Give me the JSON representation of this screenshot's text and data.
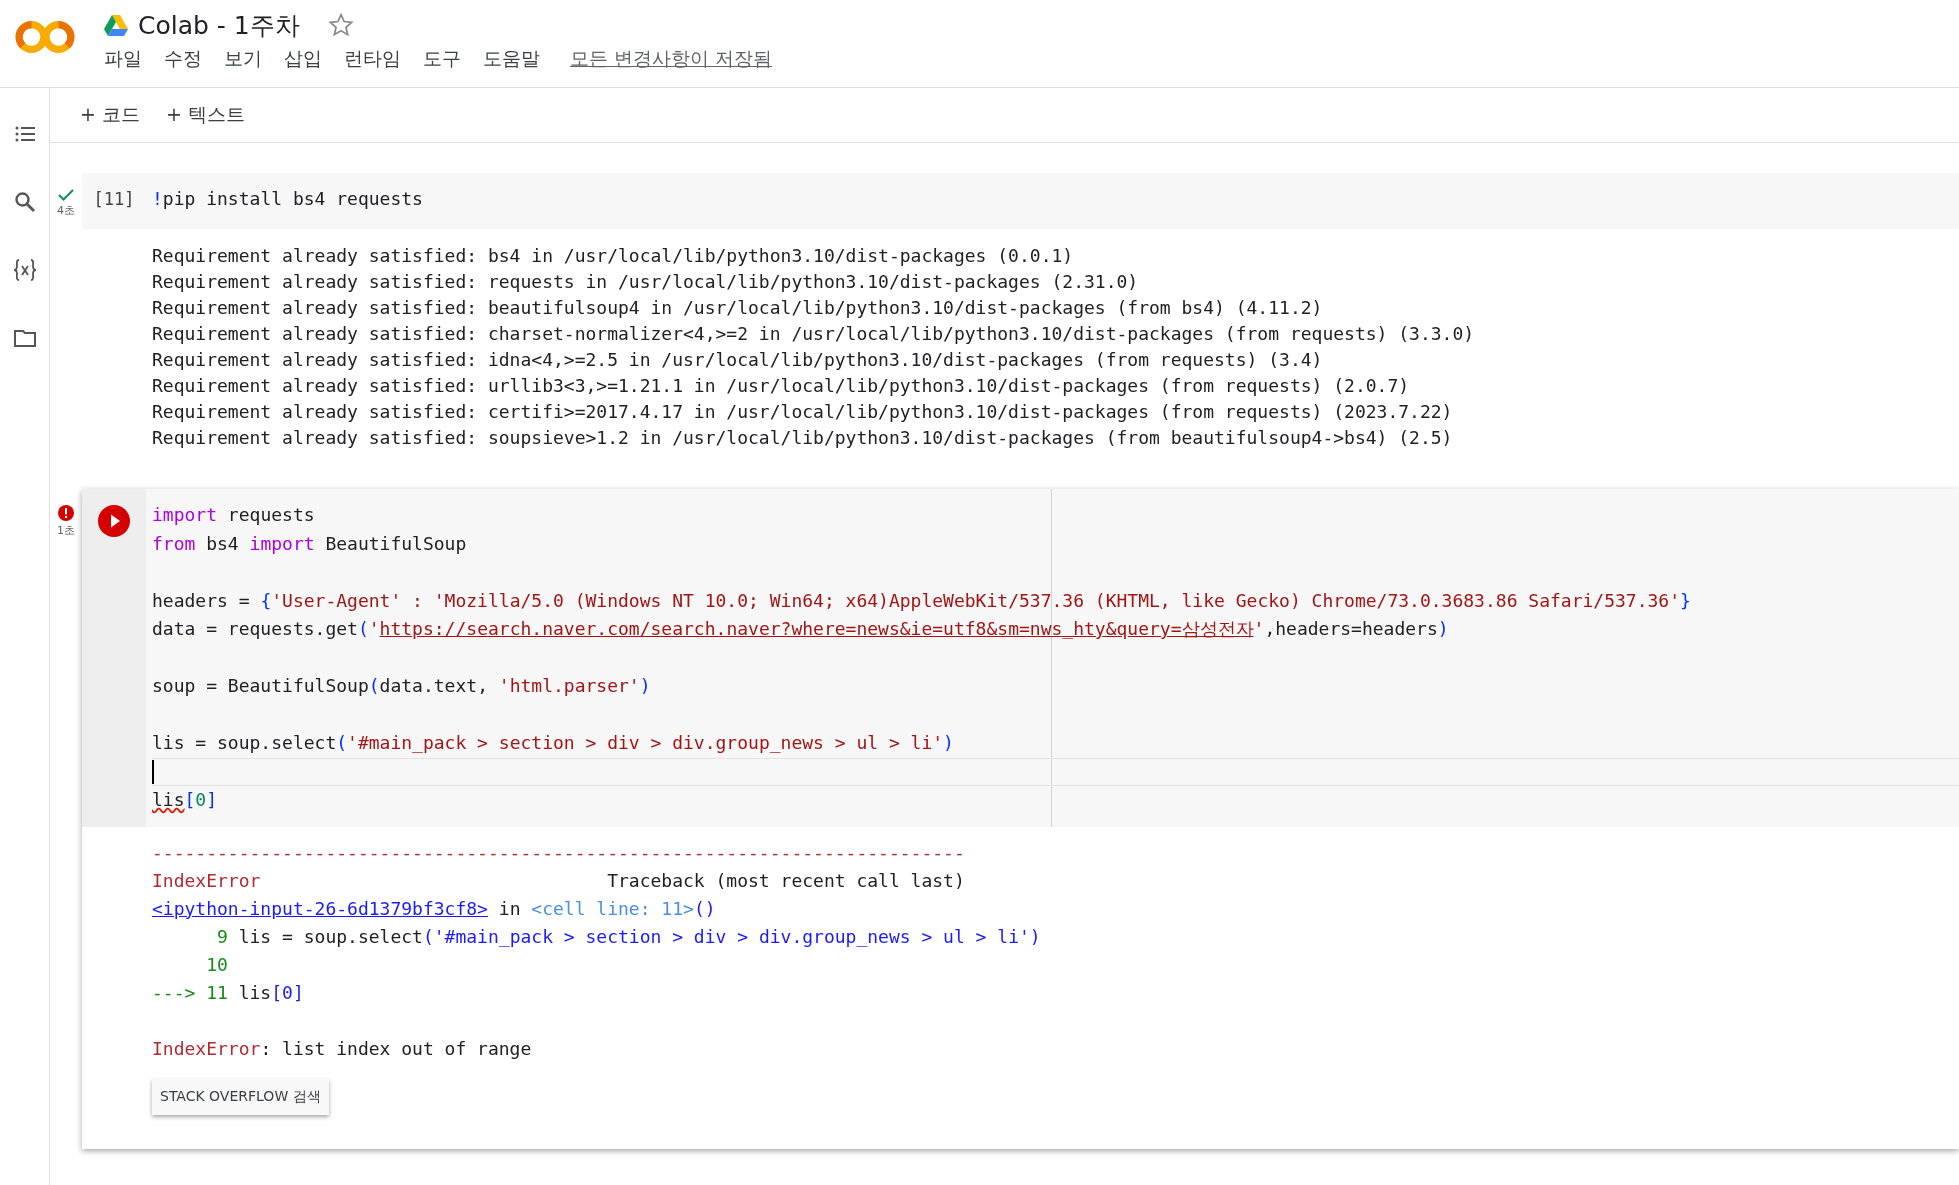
{
  "app": {
    "title": "Colab - 1주차",
    "starred": false,
    "menu": [
      "파일",
      "수정",
      "보기",
      "삽입",
      "런타임",
      "도구",
      "도움말"
    ],
    "save_status": "모든 변경사항이 저장됨"
  },
  "sidebar": [
    {
      "kind": "toc"
    },
    {
      "kind": "search"
    },
    {
      "kind": "variables"
    },
    {
      "kind": "files"
    }
  ],
  "toolbar": [
    "+ 코드",
    "+ 텍스트"
  ],
  "cells": [
    {
      "kind": "success",
      "exec_time": "4초",
      "prompt": "[11]",
      "focused": false,
      "code": [
        {
          "kind": "code",
          "tokens": [
            {
              "text": "!",
              "kind": "bracket"
            },
            {
              "text": "pip install bs4 requests",
              "kind": "plain"
            }
          ]
        }
      ],
      "output": {
        "kind": "stream",
        "lines": [
          {
            "kind": "code",
            "tokens": [
              {
                "text": "Requirement already satisfied: bs4 in /usr/local/lib/python3.10/dist-packages (0.0.1)",
                "kind": "plain"
              }
            ]
          },
          {
            "kind": "code",
            "tokens": [
              {
                "text": "Requirement already satisfied: requests in /usr/local/lib/python3.10/dist-packages (2.31.0)",
                "kind": "plain"
              }
            ]
          },
          {
            "kind": "code",
            "tokens": [
              {
                "text": "Requirement already satisfied: beautifulsoup4 in /usr/local/lib/python3.10/dist-packages (from bs4) (4.11.2)",
                "kind": "plain"
              }
            ]
          },
          {
            "kind": "code",
            "tokens": [
              {
                "text": "Requirement already satisfied: charset-normalizer<4,>=2 in /usr/local/lib/python3.10/dist-packages (from requests) (3.3.0)",
                "kind": "plain"
              }
            ]
          },
          {
            "kind": "code",
            "tokens": [
              {
                "text": "Requirement already satisfied: idna<4,>=2.5 in /usr/local/lib/python3.10/dist-packages (from requests) (3.4)",
                "kind": "plain"
              }
            ]
          },
          {
            "kind": "code",
            "tokens": [
              {
                "text": "Requirement already satisfied: urllib3<3,>=1.21.1 in /usr/local/lib/python3.10/dist-packages (from requests) (2.0.7)",
                "kind": "plain"
              }
            ]
          },
          {
            "kind": "code",
            "tokens": [
              {
                "text": "Requirement already satisfied: certifi>=2017.4.17 in /usr/local/lib/python3.10/dist-packages (from requests) (2023.7.22)",
                "kind": "plain"
              }
            ]
          },
          {
            "kind": "code",
            "tokens": [
              {
                "text": "Requirement already satisfied: soupsieve>1.2 in /usr/local/lib/python3.10/dist-packages (from beautifulsoup4->bs4) (2.5)",
                "kind": "plain"
              }
            ]
          }
        ]
      }
    },
    {
      "kind": "error",
      "exec_time": "1초",
      "focused": true,
      "code": [
        {
          "kind": "code",
          "tokens": [
            {
              "text": "import",
              "kind": "keyword"
            },
            {
              "text": " requests",
              "kind": "plain"
            }
          ]
        },
        {
          "kind": "code",
          "tokens": [
            {
              "text": "from",
              "kind": "keyword"
            },
            {
              "text": " bs4 ",
              "kind": "plain"
            },
            {
              "text": "import",
              "kind": "keyword"
            },
            {
              "text": " BeautifulSoup",
              "kind": "plain"
            }
          ]
        },
        {
          "kind": "blank"
        },
        {
          "kind": "code",
          "tokens": [
            {
              "text": "headers = ",
              "kind": "plain"
            },
            {
              "text": "{",
              "kind": "bracket"
            },
            {
              "text": "'User-Agent' : 'Mozilla/5.0 (Windows NT 10.0; Win64; x64)AppleWebKit/537.36 (KHTML, like Gecko) Chrome/73.0.3683.86 Safari/537.36'",
              "kind": "string"
            },
            {
              "text": "}",
              "kind": "bracket"
            }
          ]
        },
        {
          "kind": "code",
          "tokens": [
            {
              "text": "data = requests.get",
              "kind": "plain"
            },
            {
              "text": "(",
              "kind": "bracket"
            },
            {
              "text": "'",
              "kind": "string"
            },
            {
              "text": "https://search.naver.com/search.naver?where=news&ie=utf8&sm=nws_hty&query=삼성전자",
              "kind": "link"
            },
            {
              "text": "'",
              "kind": "string"
            },
            {
              "text": ",headers=headers",
              "kind": "plain"
            },
            {
              "text": ")",
              "kind": "bracket"
            }
          ]
        },
        {
          "kind": "blank"
        },
        {
          "kind": "code",
          "tokens": [
            {
              "text": "soup = BeautifulSoup",
              "kind": "plain"
            },
            {
              "text": "(",
              "kind": "bracket"
            },
            {
              "text": "data.text, ",
              "kind": "plain"
            },
            {
              "text": "'html.parser'",
              "kind": "string"
            },
            {
              "text": ")",
              "kind": "bracket"
            }
          ]
        },
        {
          "kind": "blank"
        },
        {
          "kind": "code",
          "tokens": [
            {
              "text": "lis = soup.select",
              "kind": "plain"
            },
            {
              "text": "(",
              "kind": "bracket"
            },
            {
              "text": "'#main_pack > section > div > div.group_news > ul > li'",
              "kind": "string"
            },
            {
              "text": ")",
              "kind": "bracket"
            }
          ]
        },
        {
          "kind": "blank",
          "cursor": true
        },
        {
          "kind": "code",
          "tokens": [
            {
              "text": "lis",
              "kind": "squiggle"
            },
            {
              "text": "[",
              "kind": "bracket"
            },
            {
              "text": "0",
              "kind": "number"
            },
            {
              "text": "]",
              "kind": "bracket"
            }
          ]
        }
      ],
      "output": {
        "kind": "error",
        "lines": [
          {
            "kind": "code",
            "tokens": [
              {
                "text": "---------------------------------------------------------------------------",
                "kind": "ename"
              }
            ]
          },
          {
            "kind": "code",
            "tokens": [
              {
                "text": "IndexError",
                "kind": "ename"
              },
              {
                "text": "                                Traceback (most recent call last)",
                "kind": "plain"
              }
            ]
          },
          {
            "kind": "code",
            "tokens": [
              {
                "text": "<ipython-input-26-6d1379bf3cf8>",
                "kind": "tblink"
              },
              {
                "text": " in ",
                "kind": "plain"
              },
              {
                "text": "<cell line: 11>",
                "kind": "tbcell"
              },
              {
                "text": "()",
                "kind": "tbparen"
              }
            ]
          },
          {
            "kind": "code",
            "tokens": [
              {
                "text": "      9",
                "kind": "lineno"
              },
              {
                "text": " lis = soup.select",
                "kind": "plain"
              },
              {
                "text": "('#main_pack > section > div > div.group_news > ul > li')",
                "kind": "tbstring"
              }
            ]
          },
          {
            "kind": "code",
            "tokens": [
              {
                "text": "     10",
                "kind": "lineno"
              }
            ]
          },
          {
            "kind": "code",
            "tokens": [
              {
                "text": "---> 11",
                "kind": "lineno"
              },
              {
                "text": " lis",
                "kind": "plain"
              },
              {
                "text": "[0]",
                "kind": "tbstring"
              }
            ]
          },
          {
            "kind": "blank"
          },
          {
            "kind": "code",
            "tokens": [
              {
                "text": "IndexError",
                "kind": "ename"
              },
              {
                "text": ": list index out of range",
                "kind": "plain"
              }
            ]
          }
        ],
        "button": "STACK OVERFLOW 검색"
      }
    }
  ]
}
